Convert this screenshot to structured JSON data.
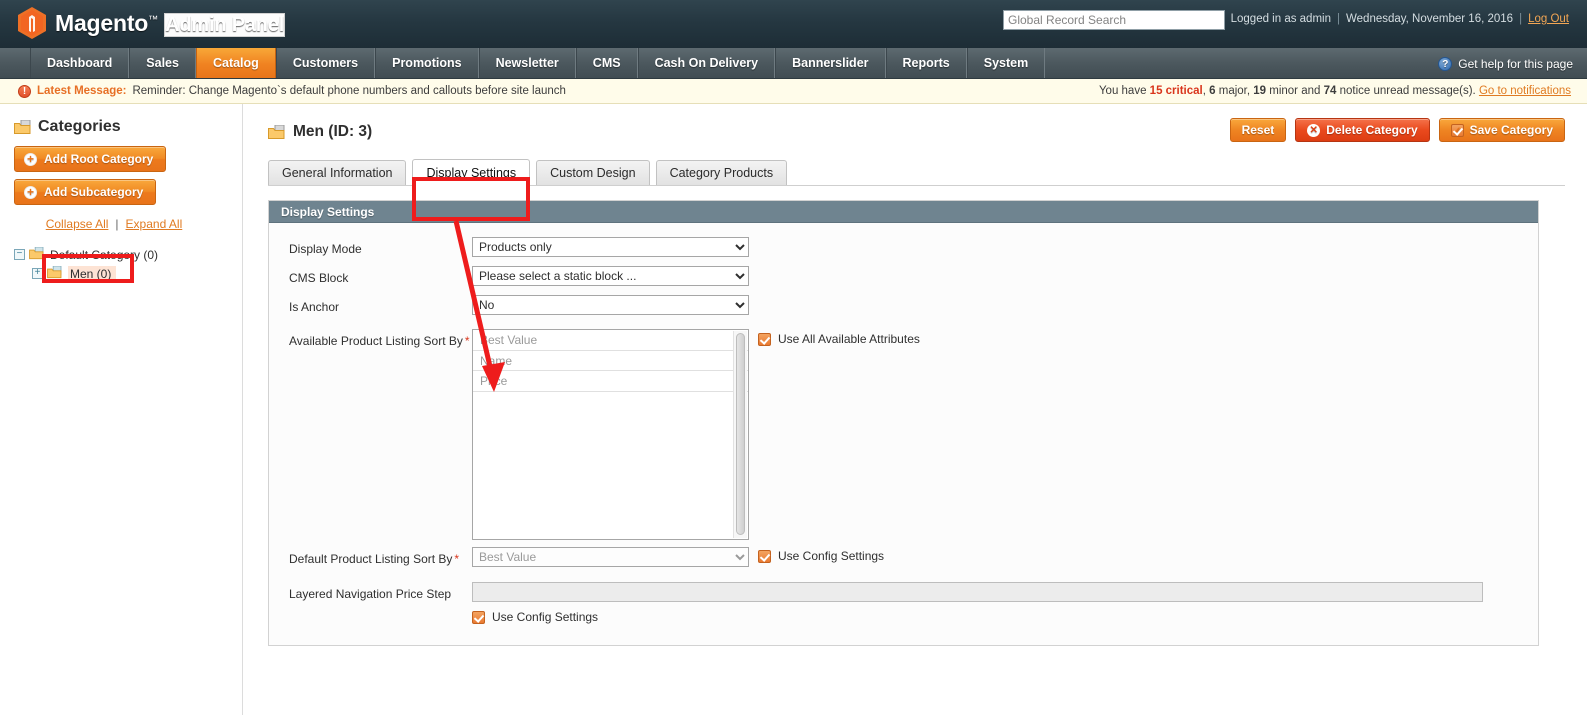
{
  "header": {
    "logo_text": "Magento",
    "logo_tm": "™",
    "logo_suffix": "Admin Panel",
    "search_placeholder": "Global Record Search",
    "search_value": "",
    "logged_in": "Logged in as admin",
    "date": "Wednesday, November 16, 2016",
    "logout": "Log Out",
    "accent": "#e8731a"
  },
  "nav": {
    "items": [
      {
        "label": "Dashboard",
        "active": false
      },
      {
        "label": "Sales",
        "active": false
      },
      {
        "label": "Catalog",
        "active": true
      },
      {
        "label": "Customers",
        "active": false
      },
      {
        "label": "Promotions",
        "active": false
      },
      {
        "label": "Newsletter",
        "active": false
      },
      {
        "label": "CMS",
        "active": false
      },
      {
        "label": "Cash On Delivery",
        "active": false
      },
      {
        "label": "Bannerslider",
        "active": false
      },
      {
        "label": "Reports",
        "active": false
      },
      {
        "label": "System",
        "active": false
      }
    ],
    "help_label": "Get help for this page",
    "help_glyph": "?"
  },
  "message_bar": {
    "icon_glyph": "!",
    "label": "Latest Message:",
    "text": "Reminder: Change Magento`s default phone numbers and callouts before site launch",
    "notice_prefix": "You have ",
    "critical_count": "15",
    "critical_word": " critical",
    "major_count": "6",
    "major_word": " major, ",
    "minor_count": "19",
    "minor_word": " minor and ",
    "notice_count": "74",
    "notice_word": " notice unread message(s). ",
    "link": "Go to notifications"
  },
  "sidebar": {
    "title": "Categories",
    "add_root_label": "Add Root Category",
    "add_sub_label": "Add Subcategory",
    "plus_glyph": "+",
    "collapse_all": "Collapse All",
    "expand_all": "Expand All",
    "divider": "|",
    "tree": [
      {
        "label": "Default Category (0)",
        "toggle": "−",
        "selected": false
      },
      {
        "label": "Men (0)",
        "toggle": "+",
        "selected": true
      }
    ]
  },
  "page": {
    "title": "Men (ID: 3)",
    "buttons": {
      "reset": "Reset",
      "delete": "Delete Category",
      "delete_glyph": "✕",
      "save": "Save Category",
      "save_glyph": "✓"
    },
    "tabs": [
      {
        "label": "General Information",
        "active": false
      },
      {
        "label": "Display Settings",
        "active": true
      },
      {
        "label": "Custom Design",
        "active": false
      },
      {
        "label": "Category Products",
        "active": false
      }
    ]
  },
  "form": {
    "section_title": "Display Settings",
    "display_mode": {
      "label": "Display Mode",
      "value": "Products only"
    },
    "cms_block": {
      "label": "CMS Block",
      "value": "Please select a static block ..."
    },
    "is_anchor": {
      "label": "Is Anchor",
      "value": "No"
    },
    "available_sort": {
      "label": "Available Product Listing Sort By",
      "required": "*",
      "options": [
        "Best Value",
        "Name",
        "Price"
      ],
      "checkbox_label": "Use All Available Attributes",
      "checked": true
    },
    "default_sort": {
      "label": "Default Product Listing Sort By",
      "required": "*",
      "value": "Best Value",
      "checkbox_label": "Use Config Settings",
      "checked": true
    },
    "price_step": {
      "label": "Layered Navigation Price Step",
      "value": "",
      "checkbox_label": "Use Config Settings",
      "checked": true
    }
  },
  "annotations": {
    "highlight_color": "#ee1c1c",
    "arrow_color": "#ee1c1c",
    "boxes": [
      "display-settings-tab",
      "men-tree-node"
    ],
    "arrow": "tab-to-available-sort"
  }
}
